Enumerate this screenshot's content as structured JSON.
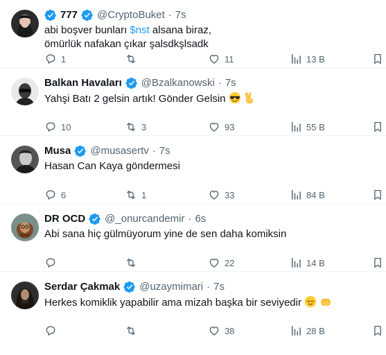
{
  "tweets": [
    {
      "name": "777",
      "handle": "@CryptoBuket",
      "time": "7s",
      "text_pre": "abi boşver bunları ",
      "cashtag": "$nst",
      "text_post": " alsana biraz,",
      "text_line2": "ömürlük nafakan çıkar şalsdkşlsadk",
      "replies": "1",
      "retweets": "",
      "likes": "11",
      "views": "13 B"
    },
    {
      "name": "Balkan Havaları",
      "handle": "@Bzalkanowski",
      "time": "7s",
      "text": "Yahşi Batı 2 gelsin artık! Gönder Gelsin",
      "replies": "10",
      "retweets": "3",
      "likes": "93",
      "views": "55 B"
    },
    {
      "name": "Musa",
      "handle": "@musasertv",
      "time": "7s",
      "text": "Hasan Can Kaya göndermesi",
      "replies": "6",
      "retweets": "1",
      "likes": "33",
      "views": "84 B"
    },
    {
      "name": "DR OCD",
      "handle": "@_onurcandemir",
      "time": "6s",
      "text": "Abi sana hiç gülmüyorum yine de sen daha komiksin",
      "replies": "",
      "retweets": "",
      "likes": "22",
      "views": "14 B"
    },
    {
      "name": "Serdar Çakmak",
      "handle": "@uzaymimari",
      "time": "7s",
      "text": "Herkes komiklik yapabilir ama mizah başka bir seviyedir",
      "replies": "",
      "retweets": "",
      "likes": "38",
      "views": "28 B"
    }
  ],
  "icons": {
    "verified": "verified-badge-icon",
    "reply": "reply-icon",
    "retweet": "retweet-icon",
    "like": "heart-icon",
    "views": "views-chart-icon",
    "bookmark": "bookmark-icon"
  },
  "colors": {
    "accent": "#1d9bf0",
    "muted": "#536471",
    "text": "#0f1419"
  },
  "separator": "·"
}
